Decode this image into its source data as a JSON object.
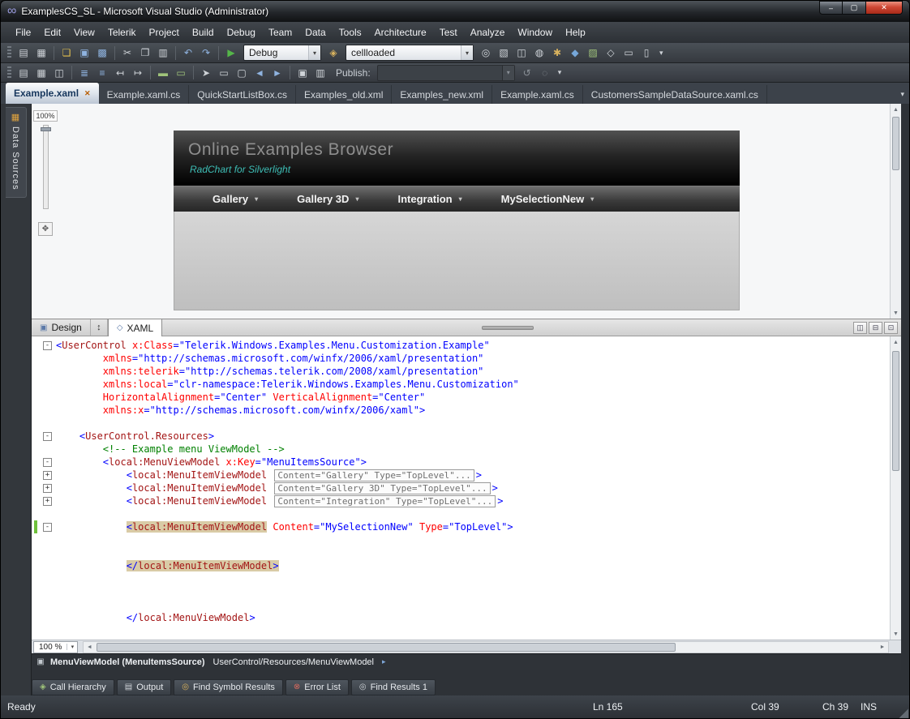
{
  "icons": {
    "logo": "∞",
    "window_min": "–",
    "window_max": "▢",
    "window_close": "✕",
    "tab_close": "✕",
    "overflow": "▾",
    "combo_arrow": "▾",
    "caret": "▾",
    "swap": "↕",
    "breadcrumb_arrow": "▸",
    "breadcrumb_element": "▣",
    "resize_grip": "◢",
    "design_fit": "✥",
    "design_tab_icon": "▣",
    "xaml_tab_icon": "◇",
    "scroll_up": "▲",
    "scroll_down": "▼",
    "scroll_left": "◄",
    "scroll_right": "►"
  },
  "window": {
    "title": "ExamplesCS_SL - Microsoft Visual Studio (Administrator)"
  },
  "menu_bar": {
    "items": [
      "File",
      "Edit",
      "View",
      "Telerik",
      "Project",
      "Build",
      "Debug",
      "Team",
      "Data",
      "Tools",
      "Architecture",
      "Test",
      "Analyze",
      "Window",
      "Help"
    ]
  },
  "toolbar1": {
    "icons_before_debug": [
      {
        "name": "new-project-icon",
        "glyph": "▤",
        "color": "#cfd3d8"
      },
      {
        "name": "add-item-icon",
        "glyph": "▦",
        "color": "#cfd3d8"
      },
      {
        "sep": true
      },
      {
        "name": "open-file-icon",
        "glyph": "❏",
        "color": "#e4c04e"
      },
      {
        "name": "save-icon",
        "glyph": "▣",
        "color": "#8fb3e0"
      },
      {
        "name": "save-all-icon",
        "glyph": "▩",
        "color": "#8fb3e0"
      },
      {
        "sep": true
      },
      {
        "name": "cut-icon",
        "glyph": "✂",
        "color": "#cfd3d8"
      },
      {
        "name": "copy-icon",
        "glyph": "❐",
        "color": "#cfd3d8"
      },
      {
        "name": "paste-icon",
        "glyph": "▥",
        "color": "#cfd3d8"
      },
      {
        "sep": true
      },
      {
        "name": "undo-icon",
        "glyph": "↶",
        "color": "#8fb3e0"
      },
      {
        "name": "redo-icon",
        "glyph": "↷",
        "color": "#8fb3e0"
      },
      {
        "sep": true
      },
      {
        "name": "start-debugging-icon",
        "glyph": "▶",
        "color": "#55b649"
      }
    ],
    "debug_combo_value": "Debug",
    "mid_icon": {
      "name": "find-in-files-icon",
      "glyph": "◈",
      "color": "#d8b25e"
    },
    "search_value": "cellloaded",
    "icons_after_search": [
      {
        "name": "find-symbol-icon",
        "glyph": "◎",
        "color": "#cfd3d8"
      },
      {
        "name": "solution-explorer-icon",
        "glyph": "▧",
        "color": "#cfd3d8"
      },
      {
        "name": "properties-window-icon",
        "glyph": "◫",
        "color": "#cfd3d8"
      },
      {
        "name": "object-browser-icon",
        "glyph": "◍",
        "color": "#cfd3d8"
      },
      {
        "name": "toolbox-icon",
        "glyph": "✱",
        "color": "#d8b25e"
      },
      {
        "name": "start-page-icon",
        "glyph": "◆",
        "color": "#76a7d9"
      },
      {
        "name": "extension-manager-icon",
        "glyph": "▨",
        "color": "#9fc37a"
      },
      {
        "name": "class-view-icon",
        "glyph": "◇",
        "color": "#cfd3d8"
      },
      {
        "name": "command-window-icon",
        "glyph": "▭",
        "color": "#cfd3d8"
      },
      {
        "name": "immediate-window-icon",
        "glyph": "▯",
        "color": "#cfd3d8"
      }
    ]
  },
  "toolbar2": {
    "icons_left": [
      {
        "name": "schema-view-icon",
        "glyph": "▤",
        "color": "#cfd3d8"
      },
      {
        "name": "data-table-icon",
        "glyph": "▦",
        "color": "#cfd3d8"
      },
      {
        "name": "relationships-icon",
        "glyph": "◫",
        "color": "#cfd3d8"
      },
      {
        "sep": true
      },
      {
        "name": "format-document-icon",
        "glyph": "≣",
        "color": "#8fb3e0"
      },
      {
        "name": "format-selection-icon",
        "glyph": "≡",
        "color": "#8fb3e0"
      },
      {
        "name": "decrease-indent-icon",
        "glyph": "↤",
        "color": "#cfd3d8"
      },
      {
        "name": "increase-indent-icon",
        "glyph": "↦",
        "color": "#cfd3d8"
      },
      {
        "sep": true
      },
      {
        "name": "comment-icon",
        "glyph": "▬",
        "color": "#9fc37a"
      },
      {
        "name": "uncomment-icon",
        "glyph": "▭",
        "color": "#9fc37a"
      },
      {
        "sep": true
      },
      {
        "name": "pointer-tool-icon",
        "glyph": "➤",
        "color": "#cfd3d8"
      },
      {
        "name": "rectangle-tool-icon",
        "glyph": "▭",
        "color": "#cfd3d8"
      },
      {
        "name": "rounded-rectangle-tool-icon",
        "glyph": "▢",
        "color": "#cfd3d8"
      },
      {
        "name": "previous-element-icon",
        "glyph": "◄",
        "color": "#8fb3e0"
      },
      {
        "name": "next-element-icon",
        "glyph": "►",
        "color": "#8fb3e0"
      },
      {
        "sep": true
      },
      {
        "name": "group-icon",
        "glyph": "▣",
        "color": "#cfd3d8"
      },
      {
        "name": "align-icon",
        "glyph": "▥",
        "color": "#cfd3d8"
      }
    ],
    "publish_label": "Publish:",
    "publish_value": "",
    "icons_right": [
      {
        "name": "publish-icon",
        "glyph": "↺",
        "color": "#8a9097"
      },
      {
        "name": "refresh-icon",
        "glyph": "◌",
        "color": "#8a9097"
      }
    ]
  },
  "tabs": [
    {
      "label": "Example.xaml",
      "active": true
    },
    {
      "label": "Example.xaml.cs"
    },
    {
      "label": "QuickStartListBox.cs"
    },
    {
      "label": "Examples_old.xml"
    },
    {
      "label": "Examples_new.xml"
    },
    {
      "label": "Example.xaml.cs"
    },
    {
      "label": "CustomersSampleDataSource.xaml.cs"
    }
  ],
  "sidebar": {
    "label": "Data Sources",
    "icon_glyph": "▦"
  },
  "design": {
    "zoom_label": "100%",
    "app": {
      "title": "Online Examples Browser",
      "subtitle": "RadChart for Silverlight",
      "menu": [
        "Gallery",
        "Gallery 3D",
        "Integration",
        "MySelectionNew"
      ]
    }
  },
  "split": {
    "design_label": "Design",
    "xaml_label": "XAML"
  },
  "editor": {
    "zoom_value": "100 %",
    "lines": [
      {
        "fold": "-",
        "tokens": [
          {
            "y": "d",
            "s": "<"
          },
          {
            "y": "e",
            "s": "UserControl"
          },
          {
            "y": "t",
            "s": " "
          },
          {
            "y": "a",
            "s": "x:Class"
          },
          {
            "y": "d",
            "s": "="
          },
          {
            "y": "v",
            "s": "\"Telerik.Windows.Examples.Menu.Customization.Example\""
          }
        ]
      },
      {
        "tokens": [
          {
            "y": "t",
            "s": "        "
          },
          {
            "y": "a",
            "s": "xmlns"
          },
          {
            "y": "d",
            "s": "="
          },
          {
            "y": "v",
            "s": "\"http://schemas.microsoft.com/winfx/2006/xaml/presentation\""
          }
        ]
      },
      {
        "tokens": [
          {
            "y": "t",
            "s": "        "
          },
          {
            "y": "a",
            "s": "xmlns:telerik"
          },
          {
            "y": "d",
            "s": "="
          },
          {
            "y": "v",
            "s": "\"http://schemas.telerik.com/2008/xaml/presentation\""
          }
        ]
      },
      {
        "tokens": [
          {
            "y": "t",
            "s": "        "
          },
          {
            "y": "a",
            "s": "xmlns:local"
          },
          {
            "y": "d",
            "s": "="
          },
          {
            "y": "v",
            "s": "\"clr-namespace:Telerik.Windows.Examples.Menu.Customization\""
          }
        ]
      },
      {
        "tokens": [
          {
            "y": "t",
            "s": "        "
          },
          {
            "y": "a",
            "s": "HorizontalAlignment"
          },
          {
            "y": "d",
            "s": "="
          },
          {
            "y": "v",
            "s": "\"Center\""
          },
          {
            "y": "t",
            "s": " "
          },
          {
            "y": "a",
            "s": "VerticalAlignment"
          },
          {
            "y": "d",
            "s": "="
          },
          {
            "y": "v",
            "s": "\"Center\""
          }
        ]
      },
      {
        "tokens": [
          {
            "y": "t",
            "s": "        "
          },
          {
            "y": "a",
            "s": "xmlns:x"
          },
          {
            "y": "d",
            "s": "="
          },
          {
            "y": "v",
            "s": "\"http://schemas.microsoft.com/winfx/2006/xaml\""
          },
          {
            "y": "d",
            "s": ">"
          }
        ]
      },
      {
        "tokens": []
      },
      {
        "fold": "-",
        "tokens": [
          {
            "y": "t",
            "s": "    "
          },
          {
            "y": "d",
            "s": "<"
          },
          {
            "y": "e",
            "s": "UserControl.Resources"
          },
          {
            "y": "d",
            "s": ">"
          }
        ]
      },
      {
        "tokens": [
          {
            "y": "t",
            "s": "        "
          },
          {
            "y": "c",
            "s": "<!-- Example menu ViewModel -->"
          }
        ]
      },
      {
        "fold": "-",
        "tokens": [
          {
            "y": "t",
            "s": "        "
          },
          {
            "y": "d",
            "s": "<"
          },
          {
            "y": "e",
            "s": "local:MenuViewModel"
          },
          {
            "y": "t",
            "s": " "
          },
          {
            "y": "a",
            "s": "x:Key"
          },
          {
            "y": "d",
            "s": "="
          },
          {
            "y": "v",
            "s": "\"MenuItemsSource\""
          },
          {
            "y": "d",
            "s": ">"
          }
        ]
      },
      {
        "fold": "+",
        "tokens": [
          {
            "y": "t",
            "s": "            "
          },
          {
            "y": "d",
            "s": "<"
          },
          {
            "y": "e",
            "s": "local:MenuItemViewModel"
          },
          {
            "y": "t",
            "s": " "
          },
          {
            "y": "b",
            "s": "Content=\"Gallery\" Type=\"TopLevel\"..."
          },
          {
            "y": "d",
            "s": ">"
          }
        ]
      },
      {
        "fold": "+",
        "tokens": [
          {
            "y": "t",
            "s": "            "
          },
          {
            "y": "d",
            "s": "<"
          },
          {
            "y": "e",
            "s": "local:MenuItemViewModel"
          },
          {
            "y": "t",
            "s": " "
          },
          {
            "y": "b",
            "s": "Content=\"Gallery 3D\" Type=\"TopLevel\"..."
          },
          {
            "y": "d",
            "s": ">"
          }
        ]
      },
      {
        "fold": "+",
        "tokens": [
          {
            "y": "t",
            "s": "            "
          },
          {
            "y": "d",
            "s": "<"
          },
          {
            "y": "e",
            "s": "local:MenuItemViewModel"
          },
          {
            "y": "t",
            "s": " "
          },
          {
            "y": "b",
            "s": "Content=\"Integration\" Type=\"TopLevel\"..."
          },
          {
            "y": "d",
            "s": ">"
          }
        ]
      },
      {
        "tokens": []
      },
      {
        "fold": "-",
        "change": true,
        "tokens": [
          {
            "y": "t",
            "s": "            "
          },
          {
            "y": "d",
            "s": "<",
            "h": 1
          },
          {
            "y": "e",
            "s": "local:MenuItemViewModel",
            "h": 1
          },
          {
            "y": "t",
            "s": " "
          },
          {
            "y": "a",
            "s": "Content"
          },
          {
            "y": "d",
            "s": "="
          },
          {
            "y": "v",
            "s": "\"MySelectionNew\""
          },
          {
            "y": "t",
            "s": " "
          },
          {
            "y": "a",
            "s": "Type"
          },
          {
            "y": "d",
            "s": "="
          },
          {
            "y": "v",
            "s": "\"TopLevel\""
          },
          {
            "y": "d",
            "s": ">"
          }
        ]
      },
      {
        "tokens": []
      },
      {
        "tokens": []
      },
      {
        "tokens": [
          {
            "y": "t",
            "s": "            "
          },
          {
            "y": "d",
            "s": "</",
            "h": 1
          },
          {
            "y": "e",
            "s": "local:MenuItemViewModel",
            "h": 1
          },
          {
            "y": "d",
            "s": ">",
            "h": 1
          }
        ]
      },
      {
        "tokens": []
      },
      {
        "tokens": []
      },
      {
        "tokens": []
      },
      {
        "tokens": [
          {
            "y": "t",
            "s": "            "
          },
          {
            "y": "d",
            "s": "</"
          },
          {
            "y": "e",
            "s": "local:MenuViewModel"
          },
          {
            "y": "d",
            "s": ">"
          }
        ]
      }
    ]
  },
  "breadcrumb": {
    "primary": "MenuViewModel (MenuItemsSource)",
    "secondary": "UserControl/Resources/MenuViewModel"
  },
  "panel_tabs": [
    {
      "label": "Call Hierarchy",
      "glyph": "◈",
      "color": "#9fc37a"
    },
    {
      "label": "Output",
      "glyph": "▤",
      "color": "#cfd3d8"
    },
    {
      "label": "Find Symbol Results",
      "glyph": "◎",
      "color": "#d8b25e"
    },
    {
      "label": "Error List",
      "glyph": "⊗",
      "color": "#d86a5e"
    },
    {
      "label": "Find Results 1",
      "glyph": "◎",
      "color": "#cfd3d8"
    }
  ],
  "status_bar": {
    "ready": "Ready",
    "ln": "Ln 165",
    "col": "Col 39",
    "ch": "Ch 39",
    "ins": "INS"
  }
}
